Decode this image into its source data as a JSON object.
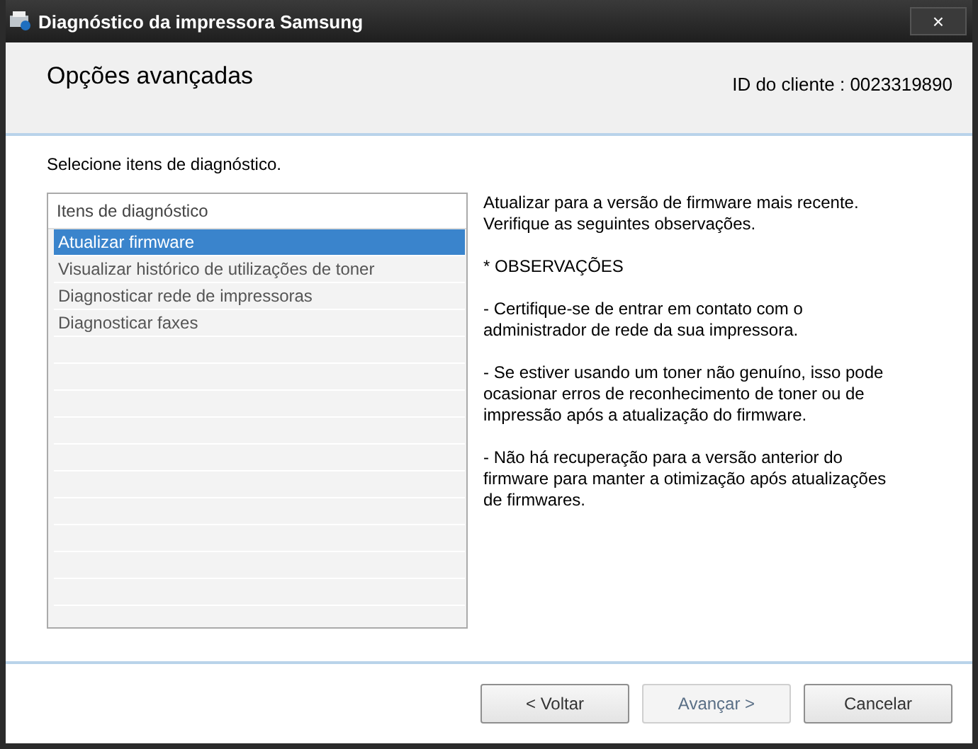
{
  "window": {
    "title": "Diagnóstico da impressora Samsung",
    "close": "×"
  },
  "header": {
    "title": "Opções avançadas",
    "client_id": "ID do cliente : 0023319890"
  },
  "instruction": "Selecione itens de diagnóstico.",
  "list": {
    "heading": "Itens de diagnóstico",
    "items": [
      {
        "label": "Atualizar firmware",
        "selected": true
      },
      {
        "label": "Visualizar histórico de utilizações de toner",
        "selected": false
      },
      {
        "label": "Diagnosticar rede de impressoras",
        "selected": false
      },
      {
        "label": "Diagnosticar faxes",
        "selected": false
      }
    ]
  },
  "description": [
    "Atualizar para a versão de firmware mais recente. Verifique as seguintes observações.",
    "* OBSERVAÇÕES",
    "- Certifique-se de entrar em contato com o administrador de rede da sua impressora.",
    "- Se estiver usando um toner não genuíno, isso pode ocasionar erros de reconhecimento de toner ou de impressão após a atualização do firmware.",
    "- Não há recuperação para a versão anterior do firmware para manter a otimização após atualizações de firmwares."
  ],
  "buttons": [
    {
      "label": "< Voltar",
      "disabled": false
    },
    {
      "label": "Avançar >",
      "disabled": true
    },
    {
      "label": "Cancelar",
      "disabled": false
    }
  ]
}
